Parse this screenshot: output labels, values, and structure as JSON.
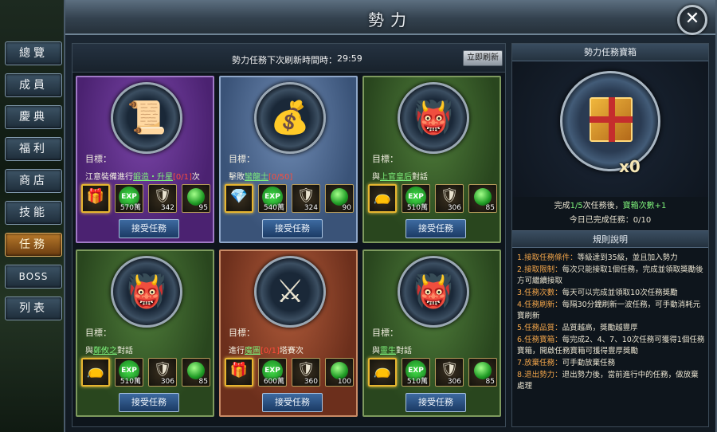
{
  "window": {
    "title": "勢力",
    "close_label": "✕"
  },
  "sidebar": {
    "items": [
      {
        "label": "總覽",
        "active": false
      },
      {
        "label": "成員",
        "active": false
      },
      {
        "label": "慶典",
        "active": false
      },
      {
        "label": "福利",
        "active": false
      },
      {
        "label": "商店",
        "active": false
      },
      {
        "label": "技能",
        "active": false
      },
      {
        "label": "任務",
        "active": true
      },
      {
        "label": "BOSS",
        "active": false
      },
      {
        "label": "列表",
        "active": false
      }
    ]
  },
  "tasks_header": {
    "refresh_label": "勢力任務下次刷新時間時：",
    "time": "29:59",
    "refresh_button": "立即刷新"
  },
  "cards": [
    {
      "color": "purple",
      "icon": "scroll-icon",
      "target_label": "目標：",
      "pre": "江意裝備進行",
      "link": "鍛造・升星",
      "progress": "[0/1]",
      "post": "次",
      "rewards": [
        {
          "icon": "chest-icon",
          "count": ""
        },
        {
          "icon": "exp-icon",
          "label": "EXP",
          "count": "570萬"
        },
        {
          "icon": "armor-icon",
          "count": "342"
        },
        {
          "icon": "gem-icon",
          "count": "95"
        }
      ],
      "accept": "接受任務"
    },
    {
      "color": "blue",
      "icon": "treasure-chest-icon",
      "target_label": "目標：",
      "pre": "擊敗",
      "link": "蠻龍士",
      "progress": "[0/50]",
      "post": "",
      "rewards": [
        {
          "icon": "jade-icon",
          "count": ""
        },
        {
          "icon": "exp-icon",
          "label": "EXP",
          "count": "540萬"
        },
        {
          "icon": "armor-icon",
          "count": "324"
        },
        {
          "icon": "gem-icon",
          "count": "90"
        }
      ],
      "accept": "接受任務"
    },
    {
      "color": "green",
      "icon": "demon-mask-icon",
      "target_label": "目標：",
      "pre": "與",
      "link": "上官皇后",
      "progress": "",
      "post": "對話",
      "rewards": [
        {
          "icon": "bag-icon",
          "count": ""
        },
        {
          "icon": "exp-icon",
          "label": "EXP",
          "count": "510萬"
        },
        {
          "icon": "armor-icon",
          "count": "306"
        },
        {
          "icon": "gem-icon",
          "count": "85"
        }
      ],
      "accept": "接受任務"
    },
    {
      "color": "green",
      "icon": "demon-mask-icon",
      "target_label": "目標：",
      "pre": "與",
      "link": "鄭攸之",
      "progress": "",
      "post": "對話",
      "rewards": [
        {
          "icon": "bag-icon",
          "count": ""
        },
        {
          "icon": "exp-icon",
          "label": "EXP",
          "count": "510萬"
        },
        {
          "icon": "armor-icon",
          "count": "306"
        },
        {
          "icon": "gem-icon",
          "count": "85"
        }
      ],
      "accept": "接受任務"
    },
    {
      "color": "red",
      "icon": "warrior-banner-icon",
      "target_label": "目標：",
      "pre": "進行",
      "link": "魔圖",
      "progress": "[0/1]",
      "post": "塔賽次",
      "rewards": [
        {
          "icon": "chest-icon",
          "count": ""
        },
        {
          "icon": "exp-icon",
          "label": "EXP",
          "count": "600萬"
        },
        {
          "icon": "armor-icon",
          "count": "360"
        },
        {
          "icon": "gem-icon",
          "count": "100"
        }
      ],
      "accept": "接受任務"
    },
    {
      "color": "green",
      "icon": "demon-mask-icon",
      "target_label": "目標：",
      "pre": "與",
      "link": "靈生",
      "progress": "",
      "post": "對話",
      "rewards": [
        {
          "icon": "bag-icon",
          "count": ""
        },
        {
          "icon": "exp-icon",
          "label": "EXP",
          "count": "510萬"
        },
        {
          "icon": "armor-icon",
          "count": "306"
        },
        {
          "icon": "gem-icon",
          "count": "85"
        }
      ],
      "accept": "接受任務"
    }
  ],
  "right_panel": {
    "title": "勢力任務寶箱",
    "chest_count": "x0",
    "complete_pre": "完成",
    "complete_num": "1/5",
    "complete_mid": "次任務後，",
    "complete_reward": "寶箱次數+1",
    "today_label": "今日已完成任務：",
    "today_value": "0/10",
    "rules_title": "規則說明",
    "rules": [
      {
        "k": "1.接取任務條件：",
        "v": "等級達到35級，並且加入勢力"
      },
      {
        "k": "2.接取限制：",
        "v": "每次只能接取1個任務，完成並領取獎勵後方可繼續接取"
      },
      {
        "k": "3.任務次數：",
        "v": "每天可以完成並領取10次任務獎勵"
      },
      {
        "k": "4.任務刷新：",
        "v": "每隔30分鐘刷新一波任務，可手動消耗元寶刷新"
      },
      {
        "k": "5.任務品質：",
        "v": "品質越高，獎勵越豐厚"
      },
      {
        "k": "6.任務寶箱：",
        "v": "每完成2、4、7、10次任務可獲得1個任務寶箱，開啟任務寶箱可獲得豐厚獎勵"
      },
      {
        "k": "7.放棄任務：",
        "v": "可手動放棄任務"
      },
      {
        "k": "8.退出勢力：",
        "v": "退出勢力後，當前進行中的任務，做放棄處理"
      }
    ]
  }
}
